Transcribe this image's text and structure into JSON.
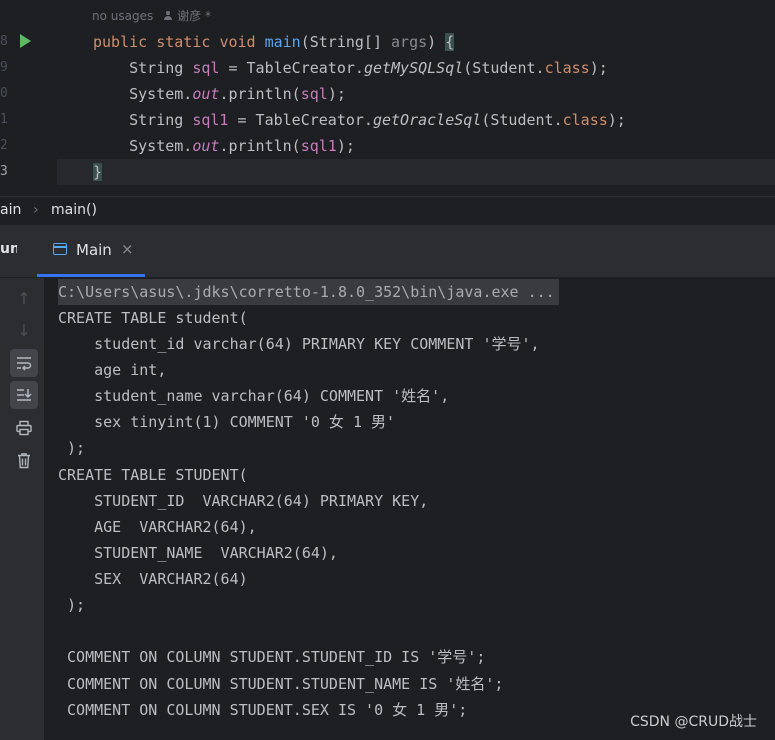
{
  "editor": {
    "usages_hint": "no usages",
    "author": "谢彦 *",
    "line_numbers": [
      "8",
      "9",
      "0",
      "1",
      "2",
      "3"
    ],
    "code": {
      "l1": {
        "kw1": "public",
        "kw2": "static",
        "kw3": "void",
        "method": "main",
        "p1": "(String[] ",
        "param": "args",
        "p2": ") ",
        "brace": "{"
      },
      "l2": {
        "indent": "    ",
        "type": "String ",
        "var": "sql",
        "eq": " = TableCreator.",
        "call": "getMySQLSql",
        "args": "(Student.",
        "kw": "class",
        "end": ");"
      },
      "l3": {
        "indent": "    ",
        "sys": "System.",
        "field": "out",
        "rest": ".println(",
        "var": "sql",
        "end": ");"
      },
      "l4": {
        "indent": "    ",
        "type": "String ",
        "var": "sql1",
        "eq": " = TableCreator.",
        "call": "getOracleSql",
        "args": "(Student.",
        "kw": "class",
        "end": ");"
      },
      "l5": {
        "indent": "    ",
        "sys": "System.",
        "field": "out",
        "rest": ".println(",
        "var": "sql1",
        "end": ");"
      },
      "l6": {
        "brace": "}"
      }
    }
  },
  "breadcrumb": {
    "file": "ain",
    "separator": "›",
    "method": "main()"
  },
  "run_window": {
    "title": "un",
    "tab_label": "Main",
    "tab_close": "×"
  },
  "toolbar": {
    "up": "↑",
    "down": "↓",
    "wrap": "⤶",
    "scroll_end": "⇲",
    "print": "⎙",
    "trash": "🗑"
  },
  "console": {
    "lines": [
      "C:\\Users\\asus\\.jdks\\corretto-1.8.0_352\\bin\\java.exe ...",
      "CREATE TABLE student(",
      "    student_id varchar(64) PRIMARY KEY COMMENT '学号',",
      "    age int,",
      "    student_name varchar(64) COMMENT '姓名',",
      "    sex tinyint(1) COMMENT '0 女 1 男'",
      " );",
      "CREATE TABLE STUDENT(",
      "    STUDENT_ID  VARCHAR2(64) PRIMARY KEY,",
      "    AGE  VARCHAR2(64),",
      "    STUDENT_NAME  VARCHAR2(64),",
      "    SEX  VARCHAR2(64)",
      " );",
      "",
      " COMMENT ON COLUMN STUDENT.STUDENT_ID IS '学号';",
      " COMMENT ON COLUMN STUDENT.STUDENT_NAME IS '姓名';",
      " COMMENT ON COLUMN STUDENT.SEX IS '0 女 1 男';"
    ]
  },
  "watermark": "CSDN @CRUD战士"
}
